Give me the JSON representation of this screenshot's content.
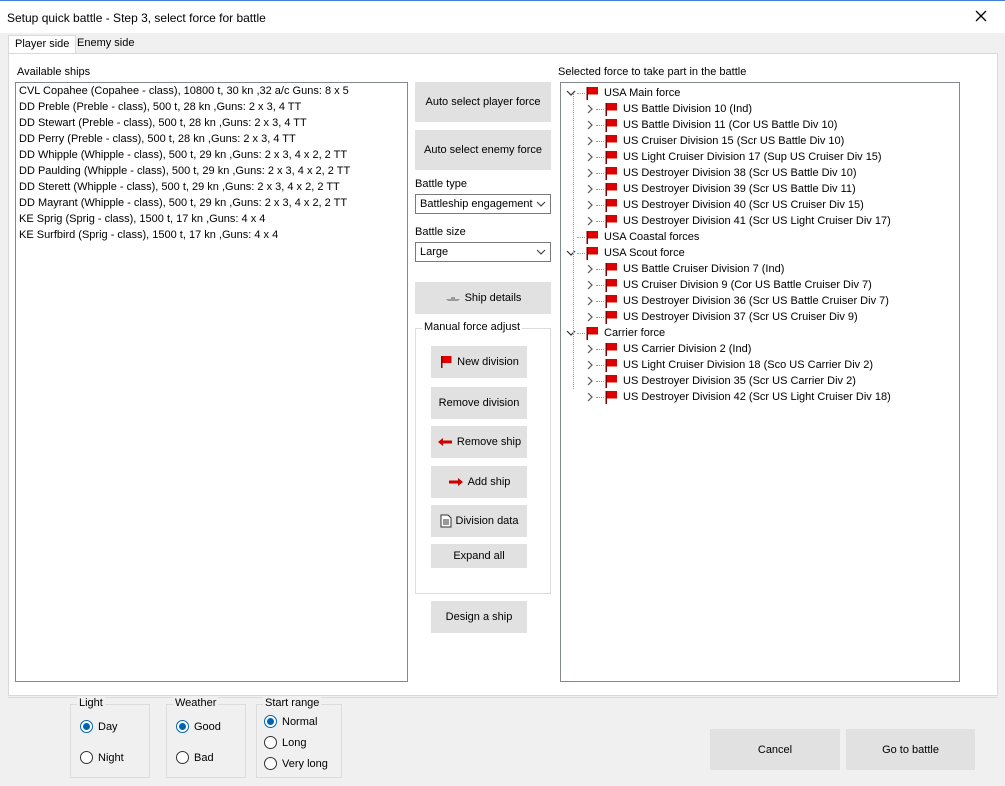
{
  "window": {
    "title": "Setup quick battle - Step 3, select force for battle"
  },
  "tabs": [
    {
      "label": "Player side",
      "active": true
    },
    {
      "label": "Enemy side",
      "active": false
    }
  ],
  "available": {
    "label": "Available ships",
    "ships": [
      "CVL Copahee (Copahee - class), 10800 t, 30 kn ,32 a/c Guns: 8 x 5",
      "DD Preble (Preble - class), 500 t, 28 kn ,Guns: 2 x 3, 4 TT",
      "DD Stewart (Preble - class), 500 t, 28 kn ,Guns: 2 x 3, 4 TT",
      "DD Perry (Preble - class), 500 t, 28 kn ,Guns: 2 x 3, 4 TT",
      "DD Whipple (Whipple - class), 500 t, 29 kn ,Guns: 2 x 3, 4 x 2, 2 TT",
      "DD Paulding (Whipple - class), 500 t, 29 kn ,Guns: 2 x 3, 4 x 2, 2 TT",
      "DD Sterett (Whipple - class), 500 t, 29 kn ,Guns: 2 x 3, 4 x 2, 2 TT",
      "DD Mayrant (Whipple - class), 500 t, 29 kn ,Guns: 2 x 3, 4 x 2, 2 TT",
      "KE Sprig (Sprig - class), 1500 t, 17 kn ,Guns: 4 x 4",
      "KE Surfbird (Sprig - class), 1500 t, 17 kn ,Guns: 4 x 4"
    ]
  },
  "controls": {
    "auto_player": "Auto select player force",
    "auto_enemy": "Auto select enemy force",
    "battle_type_label": "Battle type",
    "battle_type_value": "Battleship engagement",
    "battle_size_label": "Battle size",
    "battle_size_value": "Large",
    "ship_details": "Ship details",
    "manual_label": "Manual force adjust",
    "new_division": "New division",
    "remove_division": "Remove division",
    "remove_ship": "Remove ship",
    "add_ship": "Add ship",
    "division_data": "Division data",
    "expand_all": "Expand all",
    "design_ship": "Design a ship"
  },
  "selected": {
    "label": "Selected force to take part in the battle",
    "forces": [
      {
        "name": "USA Main force",
        "divisions": [
          "US Battle Division 10 (Ind)",
          "US Battle Division 11 (Cor US Battle Div 10)",
          "US Cruiser Division 15 (Scr US Battle Div 10)",
          "US Light Cruiser Division 17 (Sup US Cruiser Div 15)",
          "US Destroyer Division 38 (Scr US Battle Div 10)",
          "US Destroyer Division 39 (Scr US Battle Div 11)",
          "US Destroyer Division 40 (Scr US Cruiser Div 15)",
          "US Destroyer Division 41 (Scr US Light Cruiser Div 17)"
        ]
      },
      {
        "name": "USA Coastal forces",
        "divisions": []
      },
      {
        "name": "USA Scout force",
        "divisions": [
          "US Battle Cruiser Division 7 (Ind)",
          "US Cruiser Division 9 (Cor US Battle Cruiser Div 7)",
          "US Destroyer Division 36 (Scr US Battle Cruiser Div 7)",
          "US Destroyer Division 37 (Scr US Cruiser Div 9)"
        ]
      },
      {
        "name": "Carrier force",
        "divisions": [
          "US Carrier Division 2 (Ind)",
          "US Light Cruiser Division 18 (Sco US Carrier Div 2)",
          "US Destroyer Division 35 (Scr US Carrier Div 2)",
          "US Destroyer Division 42 (Scr US Light Cruiser Div 18)"
        ]
      }
    ]
  },
  "light": {
    "label": "Light",
    "options": [
      "Day",
      "Night"
    ],
    "selected": "Day"
  },
  "weather": {
    "label": "Weather",
    "options": [
      "Good",
      "Bad"
    ],
    "selected": "Good"
  },
  "start_range": {
    "label": "Start range",
    "options": [
      "Normal",
      "Long",
      "Very long"
    ],
    "selected": "Normal"
  },
  "footer": {
    "cancel": "Cancel",
    "go": "Go to battle"
  },
  "colors": {
    "flag": "#e00000",
    "accent": "#0063b1",
    "button": "#e1e1e1"
  }
}
